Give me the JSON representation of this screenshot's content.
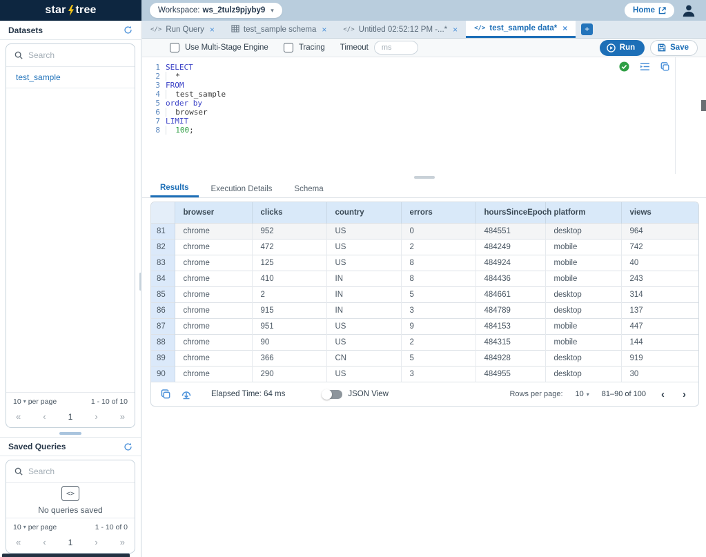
{
  "colors": {
    "accent": "#1d6fb7",
    "navy": "#0d2640",
    "topbar": "#b9cddd",
    "table_header_bg": "#d9e9f9",
    "bolt_yellow": "#f5c518",
    "success_green": "#2e9e44"
  },
  "topbar": {
    "logo_star": "star",
    "logo_tree": "tree",
    "workspace_label": "Workspace:",
    "workspace_name": "ws_2tulz9pjyby9",
    "home_label": "Home"
  },
  "sidebar": {
    "datasets": {
      "title": "Datasets",
      "search_placeholder": "Search",
      "items": [
        {
          "label": "test_sample"
        }
      ],
      "per_page_value": "10",
      "per_page_suffix": "per page",
      "range": "1 - 10 of 10",
      "page": "1"
    },
    "saved_queries": {
      "title": "Saved Queries",
      "search_placeholder": "Search",
      "empty_icon_glyph": "<>",
      "empty_text": "No queries saved",
      "per_page_value": "10",
      "per_page_suffix": "per page",
      "range": "1 - 10 of 0",
      "page": "1"
    },
    "pager_glyphs": {
      "first": "«",
      "prev": "‹",
      "next": "›",
      "last": "»"
    }
  },
  "tabs": {
    "code_glyph": "</>",
    "close_glyph": "×",
    "add_glyph": "+",
    "items": [
      {
        "label": "Run Query",
        "icon": "code",
        "active": false
      },
      {
        "label": "test_sample schema",
        "icon": "table",
        "active": false
      },
      {
        "label": "Untitled 02:52:12 PM -...*",
        "icon": "code",
        "active": false
      },
      {
        "label": "test_sample data*",
        "icon": "code",
        "active": true
      }
    ]
  },
  "toolbar": {
    "multi_stage_label": "Use Multi-Stage Engine",
    "tracing_label": "Tracing",
    "timeout_label": "Timeout",
    "timeout_placeholder": "ms",
    "run_label": "Run",
    "save_label": "Save"
  },
  "editor": {
    "lines": [
      {
        "num": "1",
        "indent": false,
        "segs": [
          [
            "kw",
            "SELECT"
          ]
        ]
      },
      {
        "num": "2",
        "indent": true,
        "segs": [
          [
            "pl",
            "*"
          ]
        ]
      },
      {
        "num": "3",
        "indent": false,
        "segs": [
          [
            "kw",
            "FROM"
          ]
        ]
      },
      {
        "num": "4",
        "indent": true,
        "segs": [
          [
            "pl",
            "test_sample"
          ]
        ]
      },
      {
        "num": "5",
        "indent": false,
        "segs": [
          [
            "kw",
            "order by"
          ]
        ]
      },
      {
        "num": "6",
        "indent": true,
        "segs": [
          [
            "pl",
            "browser"
          ]
        ]
      },
      {
        "num": "7",
        "indent": false,
        "segs": [
          [
            "kw",
            "LIMIT"
          ]
        ]
      },
      {
        "num": "8",
        "indent": true,
        "segs": [
          [
            "num",
            "100"
          ],
          [
            "pl",
            ";"
          ]
        ]
      }
    ]
  },
  "result_tabs": [
    {
      "label": "Results",
      "active": true
    },
    {
      "label": "Execution Details",
      "active": false
    },
    {
      "label": "Schema",
      "active": false
    }
  ],
  "results": {
    "columns": [
      "browser",
      "clicks",
      "country",
      "errors",
      "hoursSinceEpoch",
      "platform",
      "views"
    ],
    "rows": [
      {
        "idx": "81",
        "cells": [
          "chrome",
          "952",
          "US",
          "0",
          "484551",
          "desktop",
          "964"
        ]
      },
      {
        "idx": "82",
        "cells": [
          "chrome",
          "472",
          "US",
          "2",
          "484249",
          "mobile",
          "742"
        ]
      },
      {
        "idx": "83",
        "cells": [
          "chrome",
          "125",
          "US",
          "8",
          "484924",
          "mobile",
          "40"
        ]
      },
      {
        "idx": "84",
        "cells": [
          "chrome",
          "410",
          "IN",
          "8",
          "484436",
          "mobile",
          "243"
        ]
      },
      {
        "idx": "85",
        "cells": [
          "chrome",
          "2",
          "IN",
          "5",
          "484661",
          "desktop",
          "314"
        ]
      },
      {
        "idx": "86",
        "cells": [
          "chrome",
          "915",
          "IN",
          "3",
          "484789",
          "desktop",
          "137"
        ]
      },
      {
        "idx": "87",
        "cells": [
          "chrome",
          "951",
          "US",
          "9",
          "484153",
          "mobile",
          "447"
        ]
      },
      {
        "idx": "88",
        "cells": [
          "chrome",
          "90",
          "US",
          "2",
          "484315",
          "mobile",
          "144"
        ]
      },
      {
        "idx": "89",
        "cells": [
          "chrome",
          "366",
          "CN",
          "5",
          "484928",
          "desktop",
          "919"
        ]
      },
      {
        "idx": "90",
        "cells": [
          "chrome",
          "290",
          "US",
          "3",
          "484955",
          "desktop",
          "30"
        ]
      }
    ],
    "footer": {
      "elapsed_text": "Elapsed Time: 64 ms",
      "json_view_label": "JSON View",
      "rows_per_page_label": "Rows per page:",
      "rows_per_page_value": "10",
      "range_text": "81–90 of 100",
      "prev_glyph": "‹",
      "next_glyph": "›"
    }
  }
}
